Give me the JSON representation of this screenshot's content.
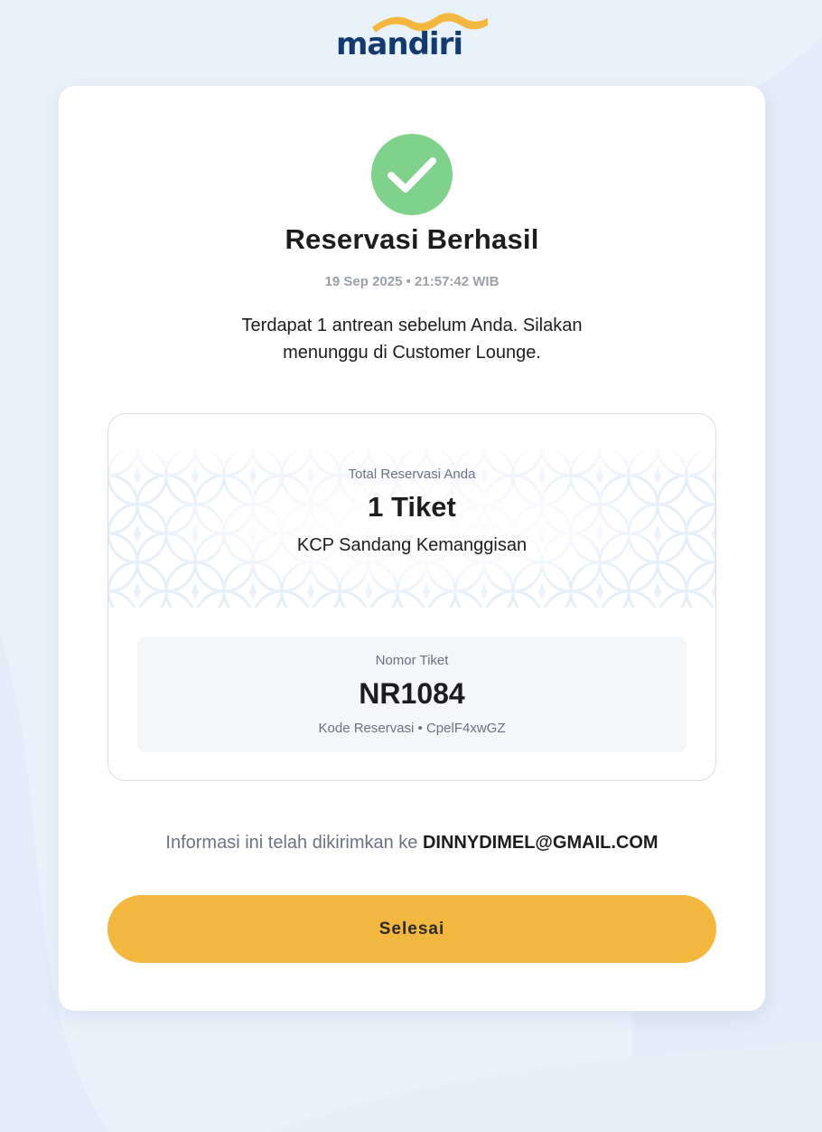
{
  "brand": {
    "logo_text": "mandiri",
    "logo_color": "#143b6f",
    "wave_color": "#f3b73f"
  },
  "status": {
    "icon": "check-circle-icon",
    "title": "Reservasi Berhasil",
    "timestamp": "19 Sep 2025 • 21:57:42 WIB",
    "message": "Terdapat 1 antrean sebelum Anda. Silakan menunggu di Customer Lounge."
  },
  "reservation": {
    "total_label": "Total Reservasi Anda",
    "total_value": "1 Tiket",
    "branch": "KCP Sandang Kemanggisan",
    "ticket_label": "Nomor Tiket",
    "ticket_number": "NR1084",
    "reservation_code": "Kode Reservasi • CpelF4xwGZ"
  },
  "notice": {
    "prefix": "Informasi ini telah dikirimkan ke",
    "email": "DINNYDIMEL@GMAIL.COM"
  },
  "actions": {
    "done_label": "Selesai"
  },
  "colors": {
    "page_background": "#e9f1fa",
    "success": "#7fd18c",
    "primary_button": "#f3b73f"
  }
}
